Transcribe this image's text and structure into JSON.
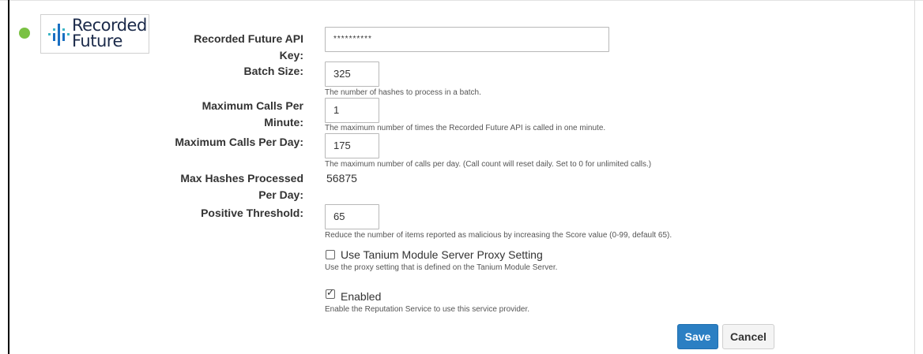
{
  "colors": {
    "status_dot": "#7ac143",
    "logo_blue": "#1a6fc2",
    "logo_teal": "#3db6c6",
    "primary_button": "#2b7fc3"
  },
  "provider": {
    "name_line1": "Recorded",
    "name_line2": "Future",
    "status_icon": "status-dot-icon"
  },
  "fields": {
    "api_key": {
      "label": "Recorded Future API Key:",
      "value": "**********"
    },
    "batch_size": {
      "label": "Batch Size:",
      "value": "325",
      "help": "The number of hashes to process in a batch."
    },
    "max_calls_minute": {
      "label": "Maximum Calls Per Minute:",
      "value": "1",
      "help": "The maximum number of times the Recorded Future API is called in one minute."
    },
    "max_calls_day": {
      "label": "Maximum Calls Per Day:",
      "value": "175",
      "help": "The maximum number of calls per day. (Call count will reset daily. Set to 0 for unlimited calls.)"
    },
    "max_hashes": {
      "label": "Max Hashes Processed Per Day:",
      "value": "56875"
    },
    "positive_threshold": {
      "label": "Positive Threshold:",
      "value": "65",
      "help": "Reduce the number of items reported as malicious by increasing the Score value (0-99, default 65)."
    }
  },
  "options": {
    "proxy": {
      "label": "Use Tanium Module Server Proxy Setting",
      "help": "Use the proxy setting that is defined on the Tanium Module Server.",
      "checked": false
    },
    "enabled": {
      "label": "Enabled",
      "help": "Enable the Reputation Service to use this service provider.",
      "checked": true,
      "check_mark": "✓"
    }
  },
  "buttons": {
    "save": "Save",
    "cancel": "Cancel"
  }
}
